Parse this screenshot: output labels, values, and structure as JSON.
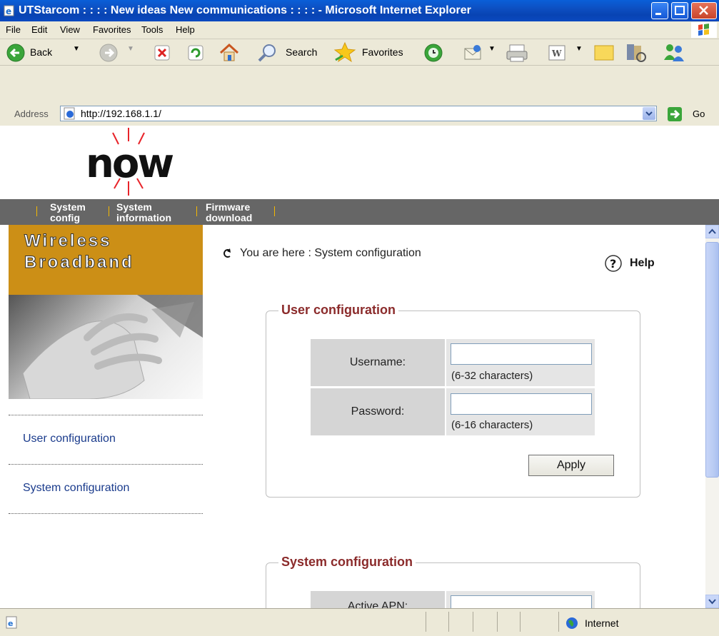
{
  "window": {
    "title": "UTStarcom : : : : New ideas New communications : : : : - Microsoft Internet Explorer"
  },
  "menu": [
    "File",
    "Edit",
    "View",
    "Favorites",
    "Tools",
    "Help"
  ],
  "toolbar": {
    "back": "Back",
    "search": "Search",
    "favorites": "Favorites"
  },
  "address": {
    "label": "Address",
    "url": "http://192.168.1.1/",
    "go": "Go"
  },
  "logo": {
    "text": "now",
    "accent": "#e8242a"
  },
  "nav": [
    {
      "label": "System config"
    },
    {
      "label": "System information"
    },
    {
      "label": "Firmware download"
    }
  ],
  "sidebar": {
    "brand_line1": "Wireless",
    "brand_line2": "Broadband",
    "brand_color": "#cc8f16",
    "items": [
      {
        "label": "User configuration"
      },
      {
        "label": "System configuration"
      }
    ]
  },
  "breadcrumb": "You are here : System configuration",
  "help_label": "Help",
  "user_config": {
    "legend": "User configuration",
    "username_label": "Username:",
    "username_hint": "(6-32 characters)",
    "password_label": "Password:",
    "password_hint": "(6-16 characters)",
    "apply": "Apply"
  },
  "system_config": {
    "legend": "System configuration",
    "apn_label": "Active APN:"
  },
  "status": {
    "zone": "Internet"
  }
}
